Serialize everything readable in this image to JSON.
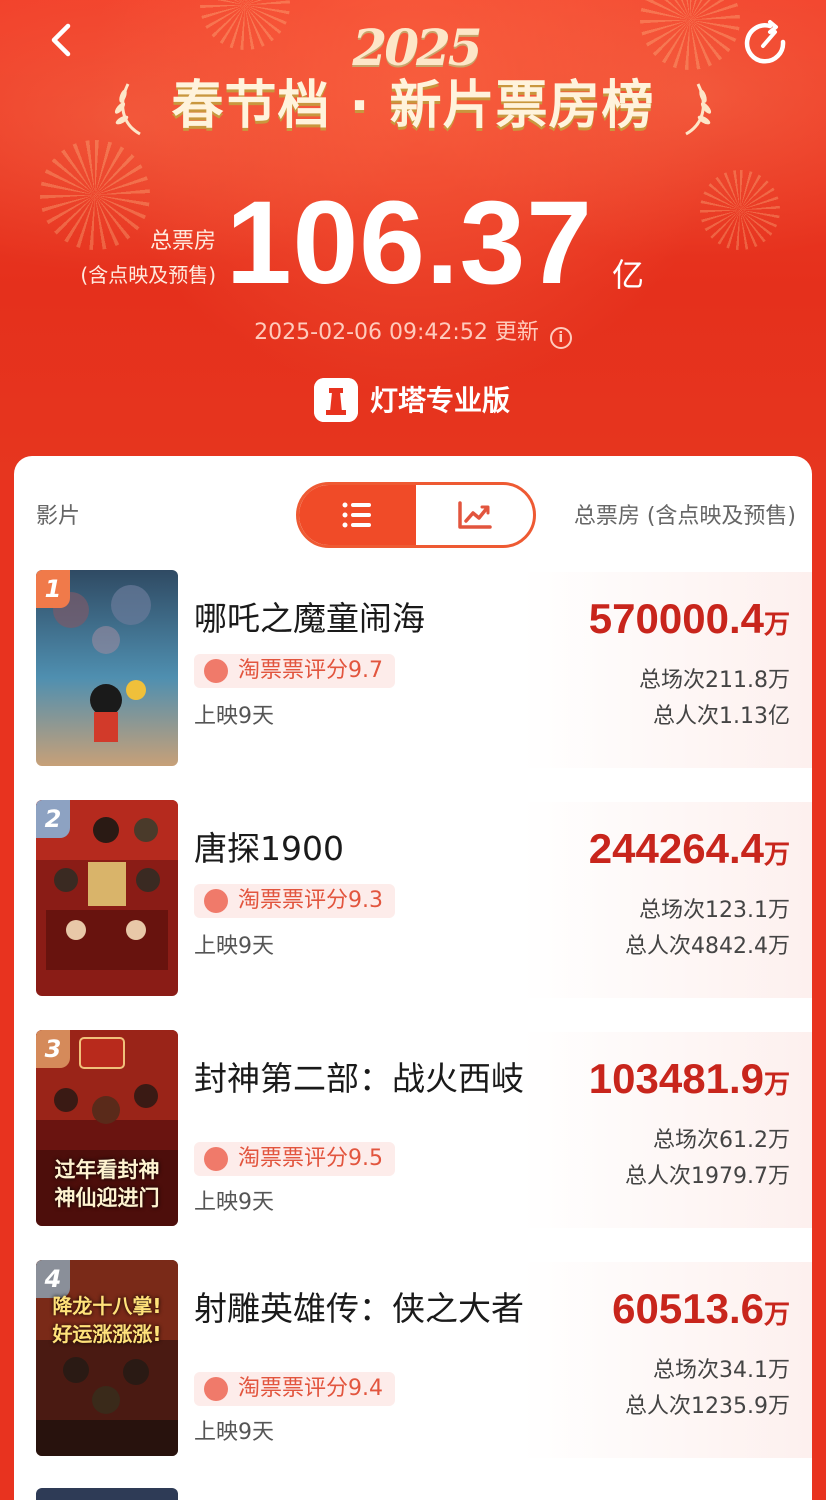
{
  "header": {
    "year": "2025",
    "title": "春节档 · 新片票房榜",
    "total_label_line1": "总票房",
    "total_label_line2": "(含点映及预售)",
    "total_value": "106.37",
    "total_unit": "亿",
    "update_time": "2025-02-06 09:42:52",
    "update_suffix": "更新",
    "brand": "灯塔专业版"
  },
  "table": {
    "col_film": "影片",
    "col_total": "总票房 (含点映及预售)",
    "view_toggle": {
      "list": "list-icon",
      "chart": "trend-chart-icon",
      "selected": "list"
    }
  },
  "films": [
    {
      "rank": "1",
      "name": "哪吒之魔童闹海",
      "rating": "淘票票评分9.7",
      "days": "上映9天",
      "box_value": "570000.4",
      "box_unit": "万",
      "sessions": "总场次211.8万",
      "viewers": "总人次1.13亿",
      "rank_color": "#f07a4a",
      "poster_colors": [
        "#3f5f7a",
        "#5f8faa",
        "#c9a07a"
      ]
    },
    {
      "rank": "2",
      "name": "唐探1900",
      "rating": "淘票票评分9.3",
      "days": "上映9天",
      "box_value": "244264.4",
      "box_unit": "万",
      "sessions": "总场次123.1万",
      "viewers": "总人次4842.4万",
      "rank_color": "#8da2c2",
      "poster_colors": [
        "#7a1a16",
        "#b3241c",
        "#4a0f0c"
      ]
    },
    {
      "rank": "3",
      "name": "封神第二部：战火西岐",
      "rating": "淘票票评分9.5",
      "days": "上映9天",
      "box_value": "103481.9",
      "box_unit": "万",
      "sessions": "总场次61.2万",
      "viewers": "总人次1979.7万",
      "rank_color": "#d58a5a",
      "poster_colors": [
        "#6a1410",
        "#a82a1c",
        "#3a0a08"
      ]
    },
    {
      "rank": "4",
      "name": "射雕英雄传：侠之大者",
      "rating": "淘票票评分9.4",
      "days": "上映9天",
      "box_value": "60513.6",
      "box_unit": "万",
      "sessions": "总场次34.1万",
      "viewers": "总人次1235.9万",
      "rank_color": "#8a8f99",
      "poster_colors": [
        "#5a1a12",
        "#9a3a20",
        "#2a1a14"
      ]
    }
  ],
  "poster_captions": {
    "film3_line1": "过年看封神",
    "film3_line2": "神仙迎进门",
    "film4_line1": "降龙十八掌!",
    "film4_line2": "好运涨涨涨!"
  }
}
